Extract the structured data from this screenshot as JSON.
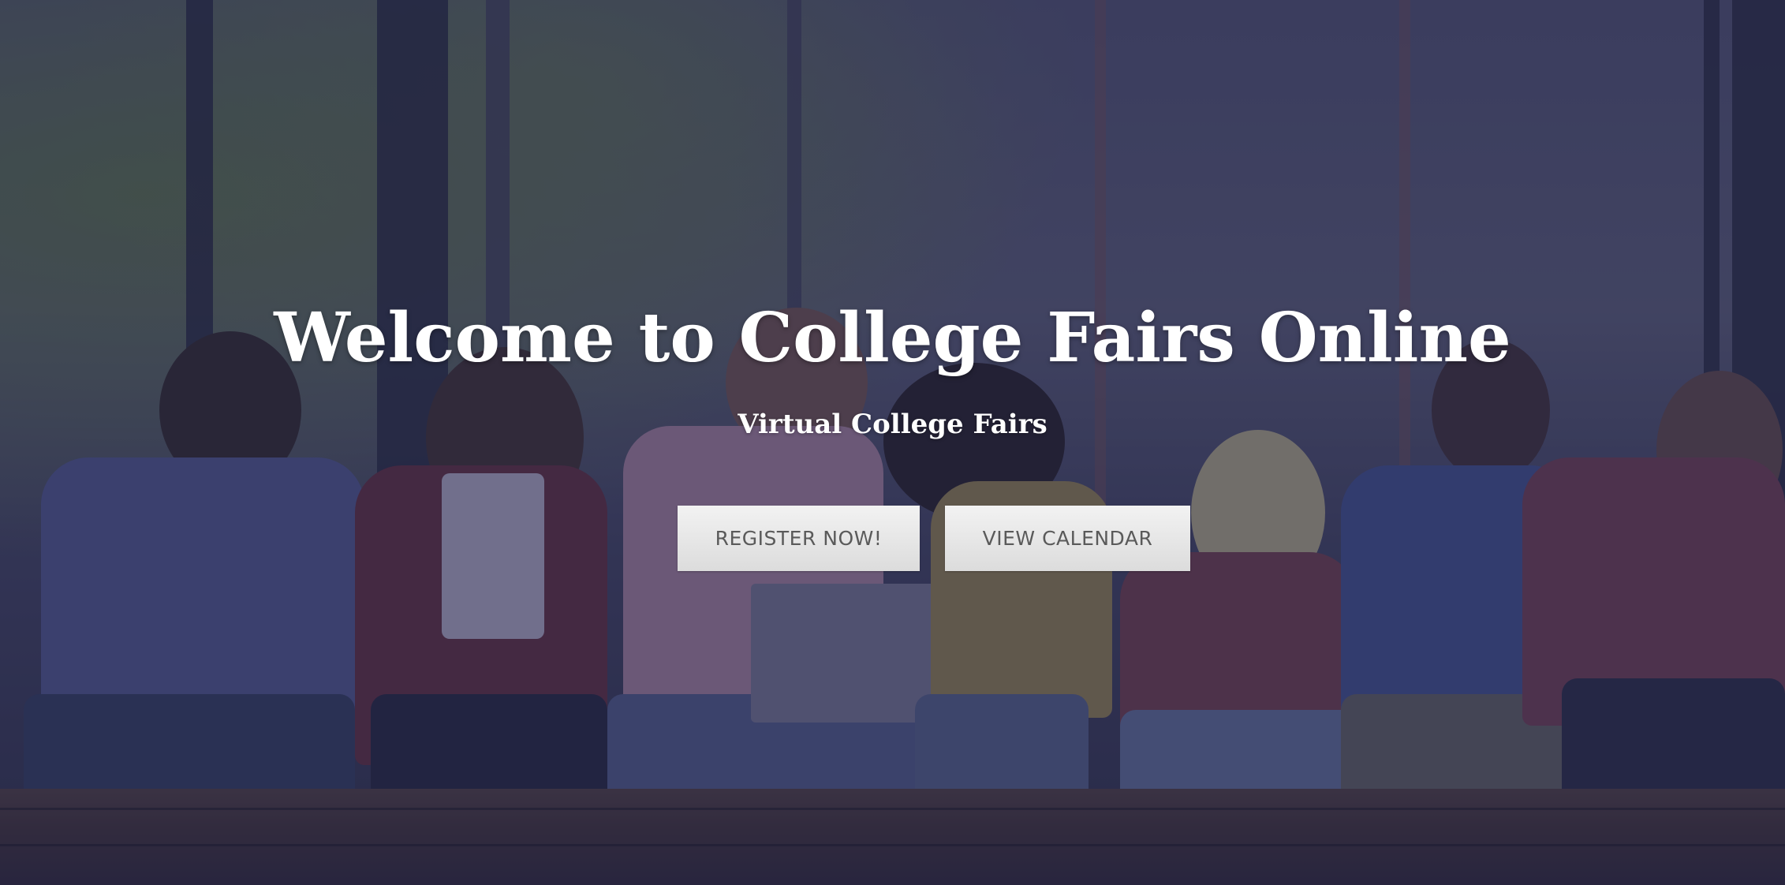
{
  "hero": {
    "title": "Welcome to College Fairs Online",
    "subtitle": "Virtual College Fairs",
    "buttons": {
      "register": "REGISTER NOW!",
      "calendar": "VIEW CALENDAR"
    }
  },
  "colors": {
    "overlay": "#26284e",
    "title_text": "#ffffff",
    "button_background": "#e6e6e6",
    "button_text": "#5a5a5a"
  }
}
